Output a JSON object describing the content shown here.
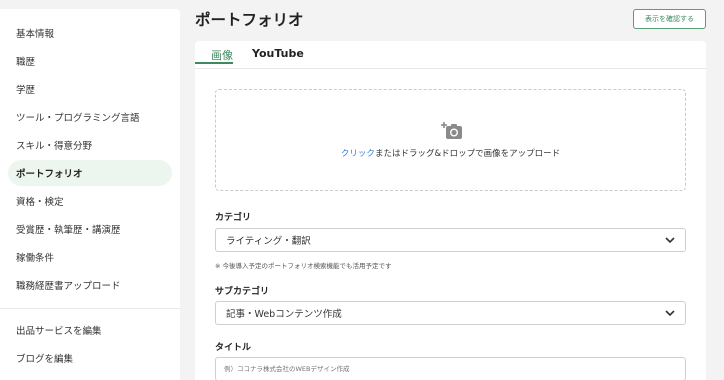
{
  "sidebar": {
    "items": [
      {
        "label": "基本情報"
      },
      {
        "label": "職歴"
      },
      {
        "label": "学歴"
      },
      {
        "label": "ツール・プログラミング言語"
      },
      {
        "label": "スキル・得意分野"
      },
      {
        "label": "ポートフォリオ"
      },
      {
        "label": "資格・検定"
      },
      {
        "label": "受賞歴・執筆歴・講演歴"
      },
      {
        "label": "稼働条件"
      },
      {
        "label": "職務経歴書アップロード"
      }
    ],
    "bottom_items": [
      {
        "label": "出品サービスを編集"
      },
      {
        "label": "ブログを編集"
      }
    ]
  },
  "header": {
    "title": "ポートフォリオ",
    "confirm_label": "表示を確認する"
  },
  "tabs": [
    {
      "label": "画像"
    },
    {
      "label": "YouTube"
    }
  ],
  "upload": {
    "link_text": "クリック",
    "rest_text": "またはドラッグ&ドロップで画像をアップロード"
  },
  "form": {
    "category_label": "カテゴリ",
    "category_value": "ライティング・翻訳",
    "note": "※ 今後導入予定のポートフォリオ検索機能でも活用予定です",
    "subcategory_label": "サブカテゴリ",
    "subcategory_value": "記事・Webコンテンツ作成",
    "title_label": "タイトル",
    "title_placeholder": "例）ココナラ株式会社のWEBデザイン作成"
  },
  "colors": {
    "accent": "#3d8a5f",
    "active_bg": "#edf5ef",
    "link": "#3a7bd5"
  }
}
